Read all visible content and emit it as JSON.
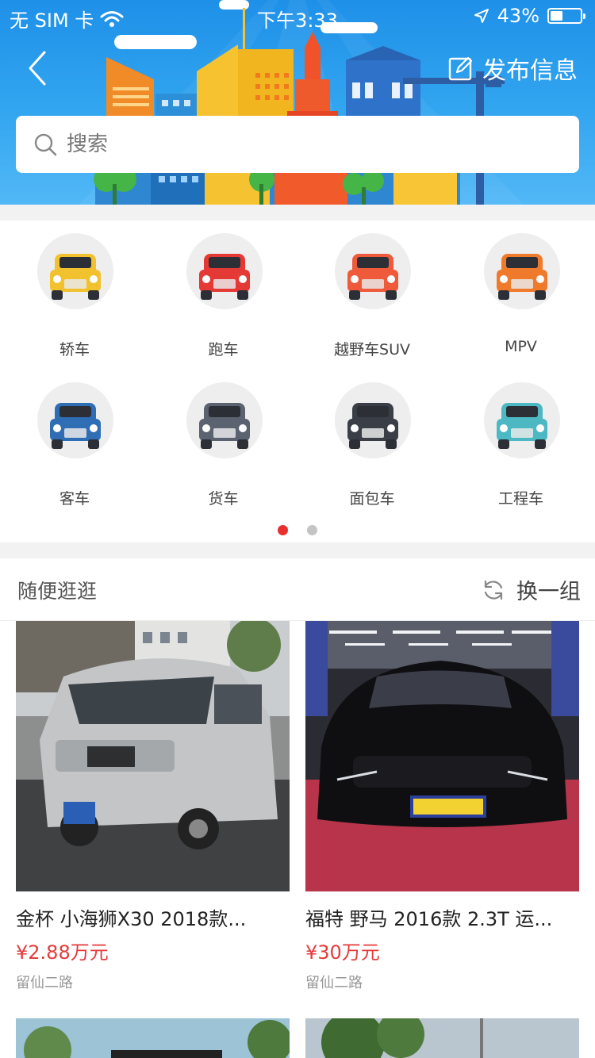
{
  "status_bar": {
    "carrier": "无 SIM 卡",
    "time": "下午3:33",
    "battery": "43%",
    "battery_level": 0.43,
    "icons": [
      "wifi-icon",
      "location-arrow-icon",
      "battery-icon"
    ]
  },
  "header": {
    "back_icon": "chevron-left-icon",
    "publish_label": "发布信息",
    "publish_icon": "edit-square-icon"
  },
  "search": {
    "placeholder": "搜索",
    "icon": "search-icon"
  },
  "categories": {
    "items": [
      {
        "label": "轿车",
        "icon": "sedan-car-icon",
        "color": "#f2c12e"
      },
      {
        "label": "跑车",
        "icon": "sports-car-icon",
        "color": "#e53935"
      },
      {
        "label": "越野车SUV",
        "icon": "suv-offroad-icon",
        "color": "#ef5a3a"
      },
      {
        "label": "MPV",
        "icon": "mpv-car-icon",
        "color": "#f07a2c"
      },
      {
        "label": "客车",
        "icon": "coach-car-icon",
        "color": "#2f6db5"
      },
      {
        "label": "货车",
        "icon": "truck-car-icon",
        "color": "#5b6270"
      },
      {
        "label": "面包车",
        "icon": "van-car-icon",
        "color": "#3a3f47"
      },
      {
        "label": "工程车",
        "icon": "engineering-car-icon",
        "color": "#4cb8c4"
      }
    ],
    "pager": {
      "pages": 2,
      "active": 0,
      "active_color": "#e8312f"
    }
  },
  "browse": {
    "title": "随便逛逛",
    "refresh_label": "换一组",
    "refresh_icon": "refresh-icon",
    "cards": [
      {
        "title": "金杯 小海狮X30 2018款...",
        "price": "¥2.88万元",
        "location": "留仙二路"
      },
      {
        "title": "福特 野马 2016款 2.3T 运...",
        "price": "¥30万元",
        "location": "留仙二路"
      }
    ],
    "price_color": "#e53b3b"
  },
  "colors": {
    "header_blue": "#1e90e8",
    "accent_red": "#e8312f"
  }
}
